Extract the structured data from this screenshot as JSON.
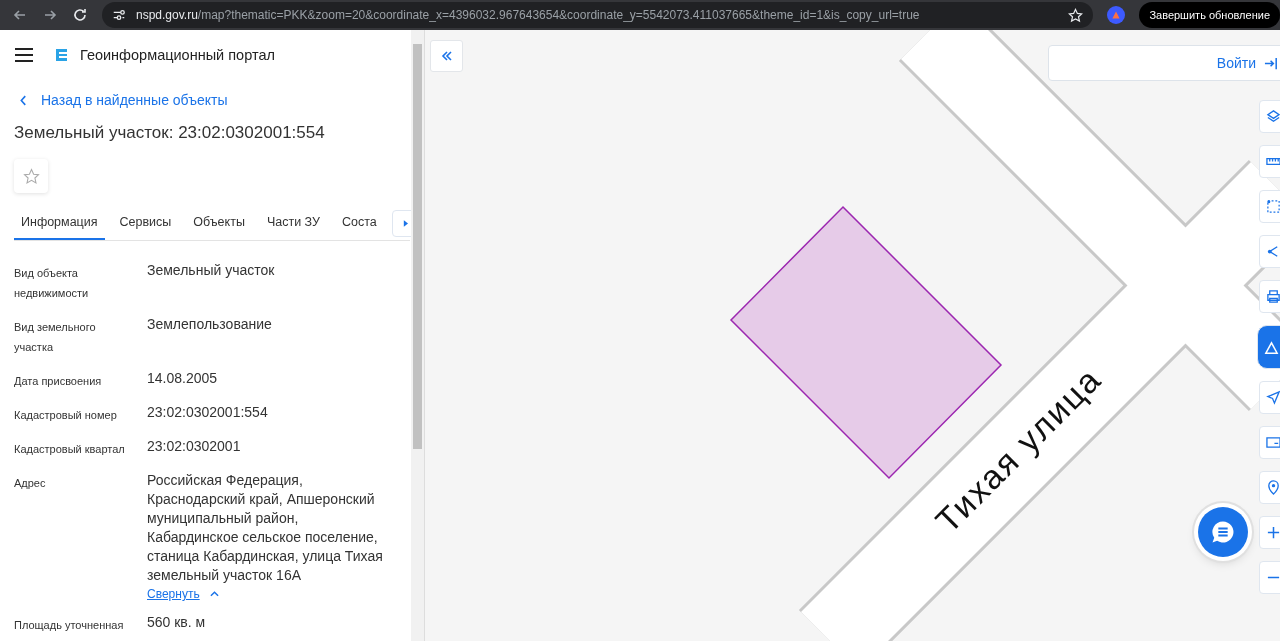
{
  "browser": {
    "url_host": "nspd.gov.ru",
    "url_path": "/map?thematic=PKK&zoom=20&coordinate_x=4396032.967643654&coordinate_y=5542073.411037665&theme_id=1&is_copy_url=true",
    "update_button": "Завершить обновление"
  },
  "sidebar": {
    "portal_title": "Геоинформационный портал",
    "back_link": "Назад в найденные объекты",
    "object_title": "Земельный участок: 23:02:0302001:554",
    "tabs": [
      {
        "label": "Информация",
        "selected": true
      },
      {
        "label": "Сервисы",
        "selected": false
      },
      {
        "label": "Объекты",
        "selected": false
      },
      {
        "label": "Части ЗУ",
        "selected": false
      },
      {
        "label": "Соста",
        "selected": false
      }
    ],
    "properties": [
      {
        "label": "Вид объекта недвижимости",
        "value": "Земельный участок"
      },
      {
        "label": "Вид земельного участка",
        "value": "Землепользование"
      },
      {
        "label": "Дата присвоения",
        "value": "14.08.2005"
      },
      {
        "label": "Кадастровый номер",
        "value": "23:02:0302001:554"
      },
      {
        "label": "Кадастровый квартал",
        "value": "23:02:0302001"
      },
      {
        "label": "Адрес",
        "value": "Российская Федерация, Краснодарский край, Апшеронский муниципальный район, Кабардинское сельское поселение, станица Кабардинская, улица Тихая земельный участок 16А",
        "link": "Свернуть"
      },
      {
        "label": "Площадь уточненная",
        "value": "560 кв. м"
      }
    ]
  },
  "map": {
    "login_button": "Войти",
    "street_label": "Тихая улица"
  }
}
